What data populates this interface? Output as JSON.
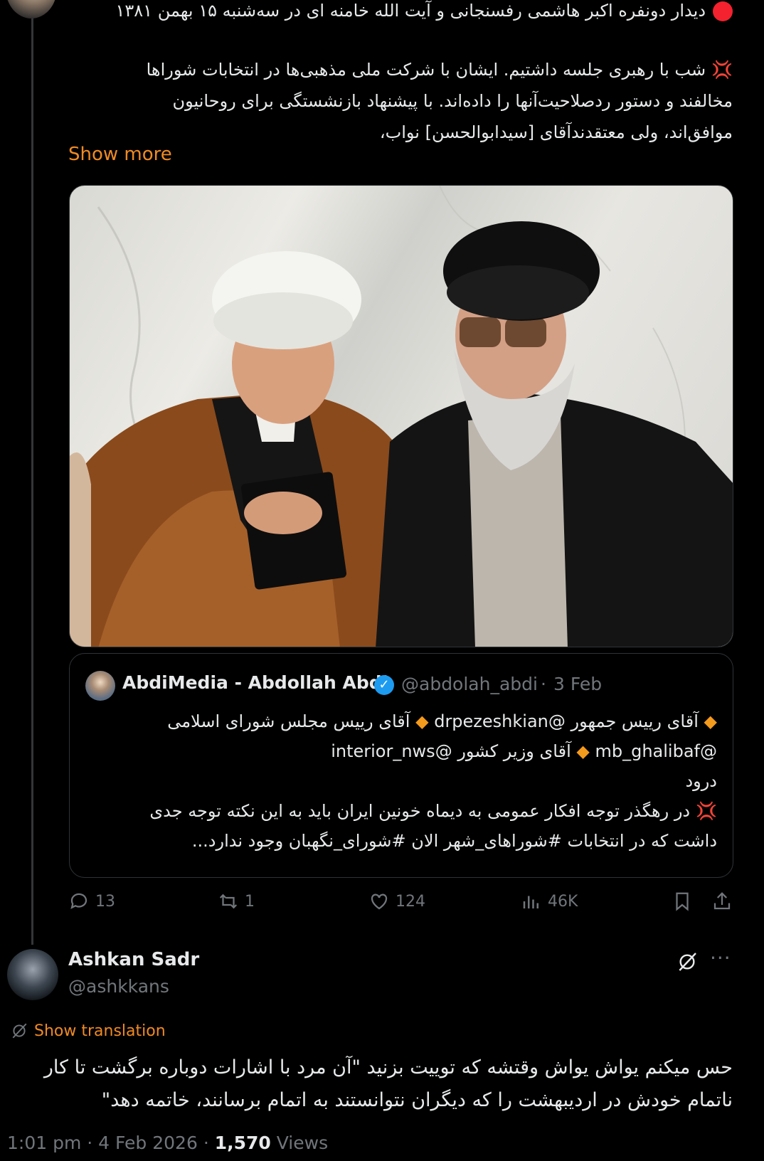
{
  "tweet": {
    "title": "دیدار دونفره اکبر هاشمی رفسنجانی و آیت الله خامنه ای در سه‌شنبه ۱۵ بهمن ۱۳۸۱",
    "body_lines": [
      "شب با رهبری جلسه داشتیم. ایشان با شرکت ملی مذهبی‌ها در انتخابات شوراها",
      "مخالفند و دستور ردصلاحیت‌آنها را داده‌اند. با پیشنهاد بازنشستگی برای روحانیون",
      "موافق‌اند، ولی معتقدندآقای [سیدابوالحسن] نواب،"
    ],
    "show_more": "Show more",
    "quote": {
      "name": "AbdiMedia - Abdollah Abdi",
      "handle": "@abdolah_abdi",
      "dot": "·",
      "date": "3 Feb",
      "line1_a": "آقای رییس جمهور",
      "line1_mention_a": "@drpezeshkian",
      "line1_b": "آقای رییس مجلس شورای اسلامی",
      "line2_mention_a": "@mb_ghalibaf",
      "line2_b": "آقای وزیر کشور",
      "line2_mention_b": "@interior_nws",
      "line3": "درود",
      "line4": "در رهگذر توجه افکار عمومی به دیماه خونین ایران باید به این نکته توجه جدی",
      "line5": "داشت که در انتخابات #شوراهای_شهر الان #شورای_نگهبان وجود ندارد..."
    },
    "actions": {
      "replies": "13",
      "reposts": "1",
      "likes": "124",
      "views": "46K"
    }
  },
  "reply": {
    "name": "Ashkan Sadr",
    "handle": "@ashkkans",
    "more": "···",
    "show_translation": "Show translation",
    "body_lines": [
      "حس میکنم یواش یواش وقتشه که توییت بزنید \"آن مرد با اشارات دوباره برگشت تا کار",
      "ناتمام خودش در اردیبهشت را که دیگران نتوانستند به اتمام برسانند، خاتمه دهد\""
    ],
    "time": "1:01 pm",
    "date": "4 Feb 2026",
    "sep": "·",
    "views_count": "1,570",
    "views_label": "Views"
  },
  "colors": {
    "background": "#000000",
    "text": "#e7e9ea",
    "muted": "#71767b",
    "accent_orange": "#f08a24",
    "verified_blue": "#1d9bf0",
    "red": "#f4212e"
  },
  "icons": [
    "red-dot-icon",
    "anger-symbol-icon",
    "verified-badge-icon",
    "reply-icon",
    "repost-icon",
    "like-icon",
    "views-icon",
    "bookmark-icon",
    "share-icon",
    "grok-icon",
    "more-icon",
    "translate-icon",
    "diamond-icon"
  ]
}
